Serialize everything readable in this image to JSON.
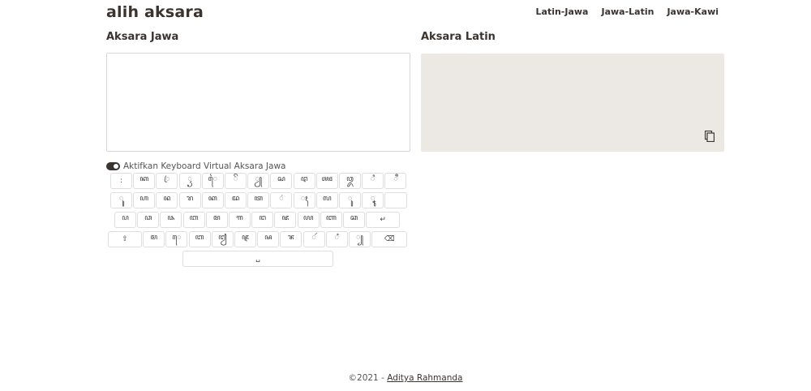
{
  "header": {
    "logo": "alih aksara",
    "nav": [
      "Latin-Jawa",
      "Jawa-Latin",
      "Jawa-Kawi"
    ]
  },
  "panels": {
    "input_title": "Aksara Jawa",
    "output_title": "Aksara Latin",
    "input_value": "",
    "output_value": ""
  },
  "keyboard": {
    "toggle_label": "Aktifkan Keyboard Virtual Aksara Jawa",
    "toggle_on": true,
    "rows": [
      [
        ":",
        "ꦏ",
        "ꦿ",
        "ꦽ",
        "ꦻ",
        "ꦼ",
        "ꦾ",
        "ꦱ",
        "ꦛ",
        "ꦖ",
        "ꦎ",
        "ꦶ",
        "ꦷ"
      ],
      [
        "ꦸ",
        "ꦲ",
        "ꦤ",
        "ꦫ",
        "ꦏ",
        "ꦢ",
        "ꦠ",
        "ꦁ",
        "ꦃ",
        "ꦭ",
        "ꦸ",
        "ꦹ",
        ""
      ],
      [
        "ꦥ",
        "ꦣ",
        "ꦦ",
        "ꦧ",
        "ꦩ",
        "ꦒ",
        "ꦔ",
        "ꦗ",
        "ꦪ",
        "ꦚ",
        "ꦕ",
        "↵"
      ],
      [
        "⇧",
        "ꦩ",
        "ꦺ",
        "ꦧ",
        "ꦙ",
        "ꦘ",
        "ꦰ",
        "ꦨ",
        "ꦂ",
        "ꦀ",
        "꧀",
        "⌫"
      ],
      [
        "␣"
      ]
    ]
  },
  "footer": {
    "copyright": "©2021 - ",
    "author": "Aditya Rahmanda"
  },
  "colors": {
    "text": "#3a3430",
    "output_bg": "#ece8e4",
    "border": "#d8d8d8"
  },
  "icons": {
    "copy": "copy-icon"
  }
}
